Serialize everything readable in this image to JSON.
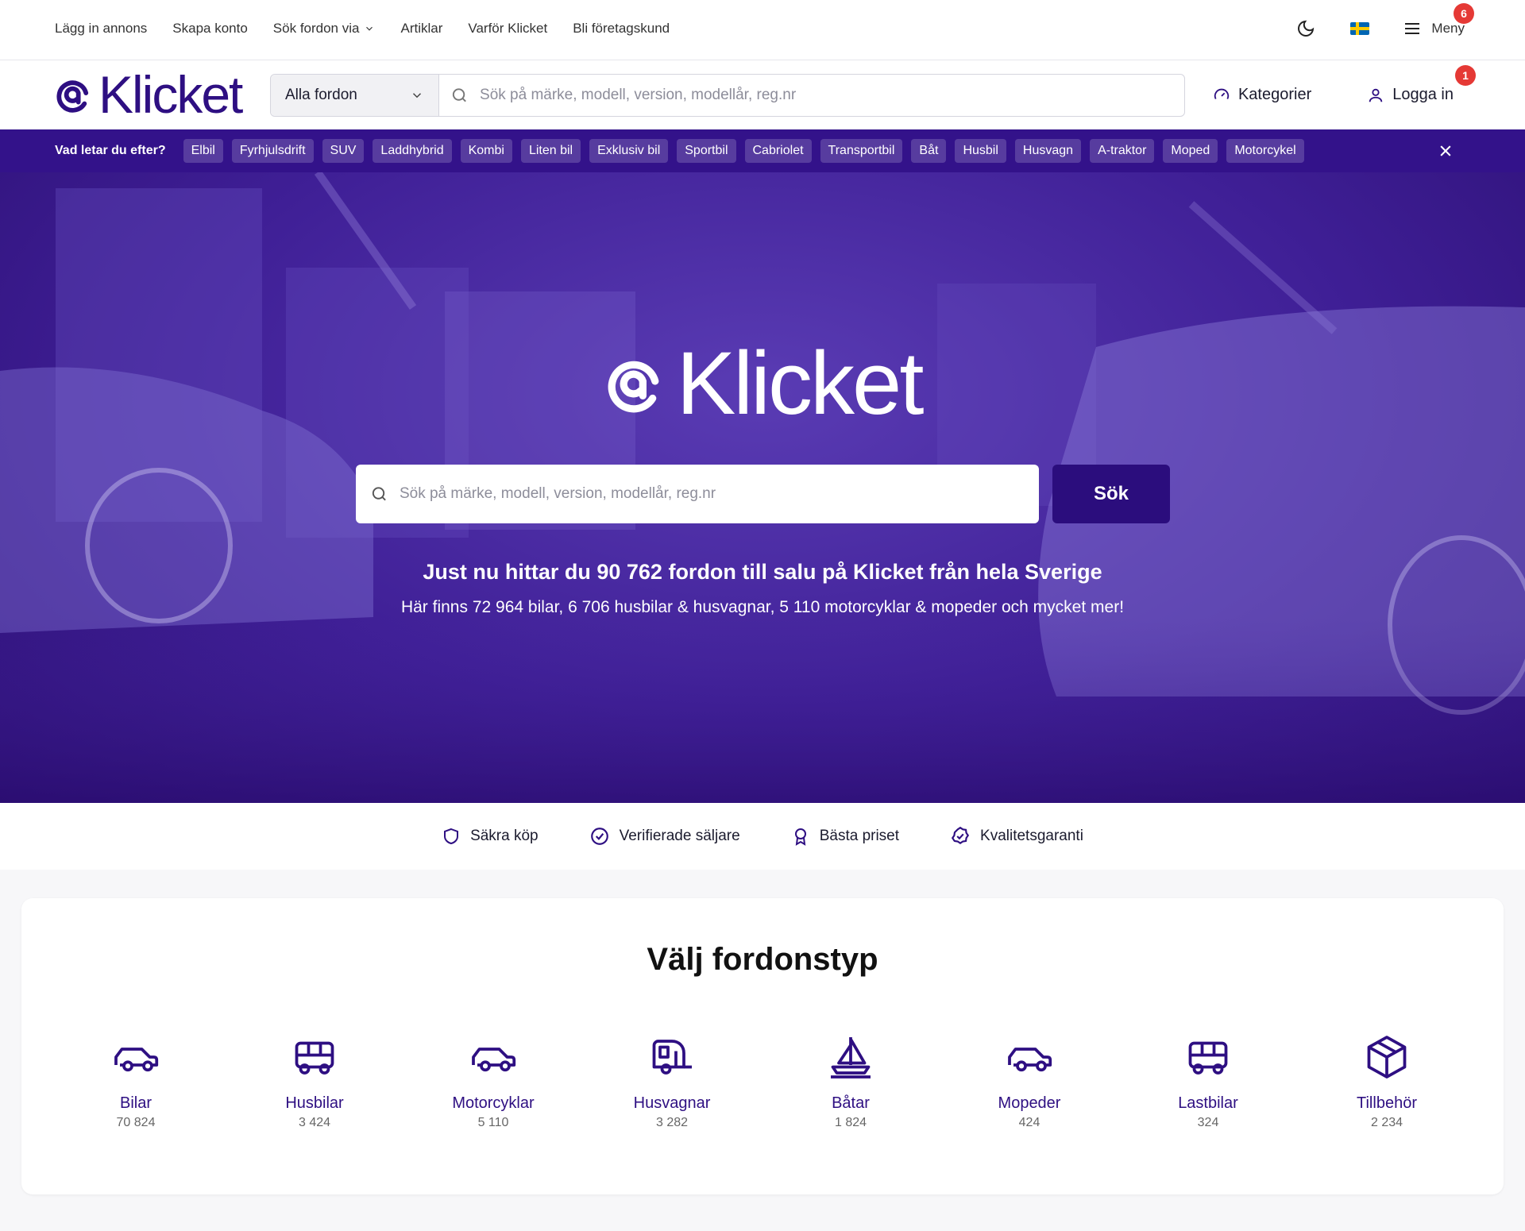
{
  "topnav": {
    "items": [
      "Lägg in annons",
      "Skapa konto",
      "Sök fordon via",
      "Artiklar",
      "Varför Klicket",
      "Bli företagskund"
    ],
    "menu_label": "Meny",
    "menu_badge": "6"
  },
  "header": {
    "logo_text": "Klicket",
    "category_select": "Alla fordon",
    "search_placeholder": "Sök på märke, modell, version, modellår, reg.nr",
    "categories_label": "Kategorier",
    "login_label": "Logga in",
    "login_badge": "1"
  },
  "chipbar": {
    "label": "Vad letar du efter?",
    "chips": [
      "Elbil",
      "Fyrhjulsdrift",
      "SUV",
      "Laddhybrid",
      "Kombi",
      "Liten bil",
      "Exklusiv bil",
      "Sportbil",
      "Cabriolet",
      "Transportbil",
      "Båt",
      "Husbil",
      "Husvagn",
      "A-traktor",
      "Moped",
      "Motorcykel"
    ]
  },
  "hero": {
    "logo_text": "Klicket",
    "search_placeholder": "Sök på märke, modell, version, modellår, reg.nr",
    "search_button": "Sök",
    "headline": "Just nu hittar du 90 762 fordon till salu på Klicket från hela Sverige",
    "subline": "Här finns 72 964 bilar, 6 706 husbilar & husvagnar, 5 110 motorcyklar & mopeder och mycket mer!"
  },
  "usps": [
    {
      "label": "Säkra köp",
      "icon": "shield-icon"
    },
    {
      "label": "Verifierade säljare",
      "icon": "check-circle-icon"
    },
    {
      "label": "Bästa priset",
      "icon": "award-icon"
    },
    {
      "label": "Kvalitetsgaranti",
      "icon": "badge-check-icon"
    }
  ],
  "vehicle_types": {
    "title": "Välj fordonstyp",
    "items": [
      {
        "name": "Bilar",
        "count": "70 824",
        "icon": "car-icon"
      },
      {
        "name": "Husbilar",
        "count": "3 424",
        "icon": "bus-icon"
      },
      {
        "name": "Motorcyklar",
        "count": "5 110",
        "icon": "car-icon"
      },
      {
        "name": "Husvagnar",
        "count": "3 282",
        "icon": "caravan-icon"
      },
      {
        "name": "Båtar",
        "count": "1 824",
        "icon": "sailboat-icon"
      },
      {
        "name": "Mopeder",
        "count": "424",
        "icon": "car-icon"
      },
      {
        "name": "Lastbilar",
        "count": "324",
        "icon": "bus-icon"
      },
      {
        "name": "Tillbehör",
        "count": "2 234",
        "icon": "box-icon"
      }
    ]
  },
  "colors": {
    "brand": "#2e0f82",
    "chipbar": "#33128a",
    "badge": "#e53935"
  }
}
